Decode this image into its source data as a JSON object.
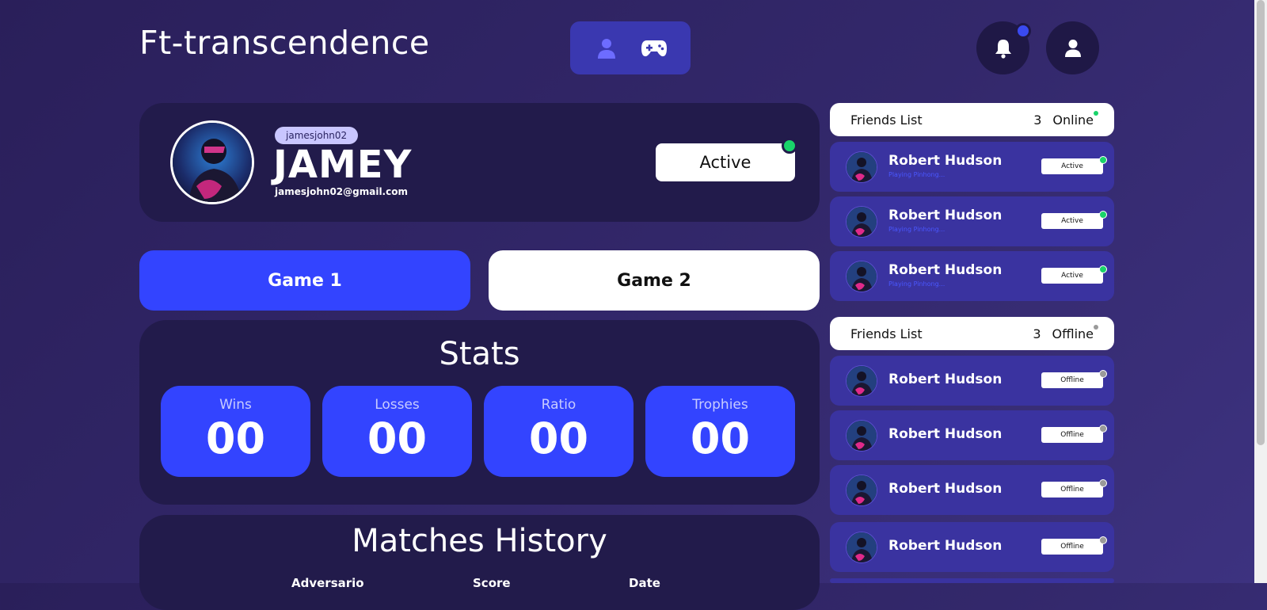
{
  "app": {
    "title": "Ft-transcendence"
  },
  "nav": {
    "profile_icon": "user-icon",
    "game_icon": "gamepad-icon"
  },
  "header": {
    "notifications_icon": "bell-icon",
    "account_icon": "user-icon"
  },
  "profile": {
    "username": "jamesjohn02",
    "display_name": "JAMEY",
    "email": "jamesjohn02@gmail.com",
    "status": "Active",
    "status_color": "#19d36a"
  },
  "games": {
    "game1_label": "Game 1",
    "game2_label": "Game 2"
  },
  "stats": {
    "title": "Stats",
    "items": [
      {
        "label": "Wins",
        "value": "00"
      },
      {
        "label": "Losses",
        "value": "00"
      },
      {
        "label": "Ratio",
        "value": "00"
      },
      {
        "label": "Trophies",
        "value": "00"
      }
    ]
  },
  "history": {
    "title": "Matches History",
    "columns": [
      "Adversario",
      "Score",
      "Date"
    ]
  },
  "friends_online": {
    "title": "Friends List",
    "count": "3",
    "label": "Online",
    "items": [
      {
        "name": "Robert Hudson",
        "activity": "Playing Pinhong...",
        "status": "Active"
      },
      {
        "name": "Robert Hudson",
        "activity": "Playing Pinhong...",
        "status": "Active"
      },
      {
        "name": "Robert Hudson",
        "activity": "Playing Pinhong...",
        "status": "Active"
      }
    ]
  },
  "friends_offline": {
    "title": "Friends List",
    "count": "3",
    "label": "Offline",
    "items": [
      {
        "name": "Robert Hudson",
        "status": "Offline"
      },
      {
        "name": "Robert Hudson",
        "status": "Offline"
      },
      {
        "name": "Robert Hudson",
        "status": "Offline"
      },
      {
        "name": "Robert Hudson",
        "status": "Offline"
      }
    ]
  },
  "colors": {
    "accent": "#3344ff",
    "online": "#19d36a",
    "offline": "#9a9a9a",
    "card": "#221b4b"
  }
}
